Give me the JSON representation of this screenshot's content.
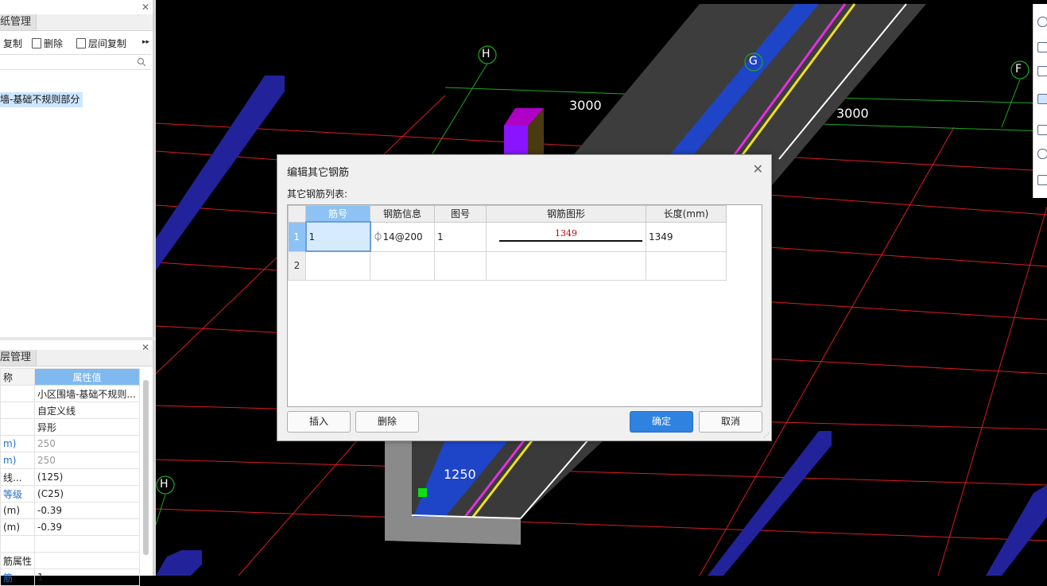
{
  "colors": {
    "accent": "#2f82e0",
    "header_highlight": "#8ec2f4",
    "dimension_red": "#c00000"
  },
  "drawing_panel": {
    "tab": "纸管理",
    "toolbar": {
      "copy": "复制",
      "delete": "删除",
      "floor_copy": "层间复制",
      "more": "▸▸"
    },
    "selected_item": "墙-基础不规则部分"
  },
  "property_panel": {
    "tab": "层管理",
    "header_name": "称",
    "header_value": "属性值",
    "rows": [
      {
        "name": "",
        "value": "小区围墙-基础不规则...",
        "name_blue": false,
        "value_gray": false
      },
      {
        "name": "",
        "value": "自定义线",
        "name_blue": false,
        "value_gray": false
      },
      {
        "name": "",
        "value": "异形",
        "name_blue": false,
        "value_gray": false
      },
      {
        "name": "m)",
        "value": "250",
        "name_blue": true,
        "value_gray": true
      },
      {
        "name": "m)",
        "value": "250",
        "name_blue": true,
        "value_gray": true
      },
      {
        "name": "线...",
        "value": "(125)",
        "name_blue": false,
        "value_gray": false
      },
      {
        "name": "等级",
        "value": "(C25)",
        "name_blue": true,
        "value_gray": false
      },
      {
        "name": "(m)",
        "value": "-0.39",
        "name_blue": false,
        "value_gray": false
      },
      {
        "name": "(m)",
        "value": "-0.39",
        "name_blue": false,
        "value_gray": false
      },
      {
        "name": "",
        "value": "",
        "name_blue": false,
        "value_gray": false
      },
      {
        "name": "筋属性",
        "value": "",
        "name_blue": false,
        "value_gray": false
      },
      {
        "name": "筋",
        "value": "1",
        "name_blue": true,
        "value_gray": false
      }
    ]
  },
  "viewport": {
    "axis_labels": [
      "H",
      "G",
      "F",
      "H"
    ],
    "dimensions": [
      "3000",
      "3000",
      "1250"
    ]
  },
  "dialog": {
    "title": "编辑其它钢筋",
    "subtitle": "其它钢筋列表:",
    "columns": [
      "筋号",
      "钢筋信息",
      "图号",
      "钢筋图形",
      "长度(mm)"
    ],
    "rows": [
      {
        "index": "1",
        "bar_no": "1",
        "rebar_info": "⏀14@200",
        "figure_no": "1",
        "shape_value": "1349",
        "length": "1349"
      },
      {
        "index": "2",
        "bar_no": "",
        "rebar_info": "",
        "figure_no": "",
        "shape_value": "",
        "length": ""
      }
    ],
    "buttons": {
      "insert": "插入",
      "delete": "删除",
      "ok": "确定",
      "cancel": "取消"
    }
  }
}
